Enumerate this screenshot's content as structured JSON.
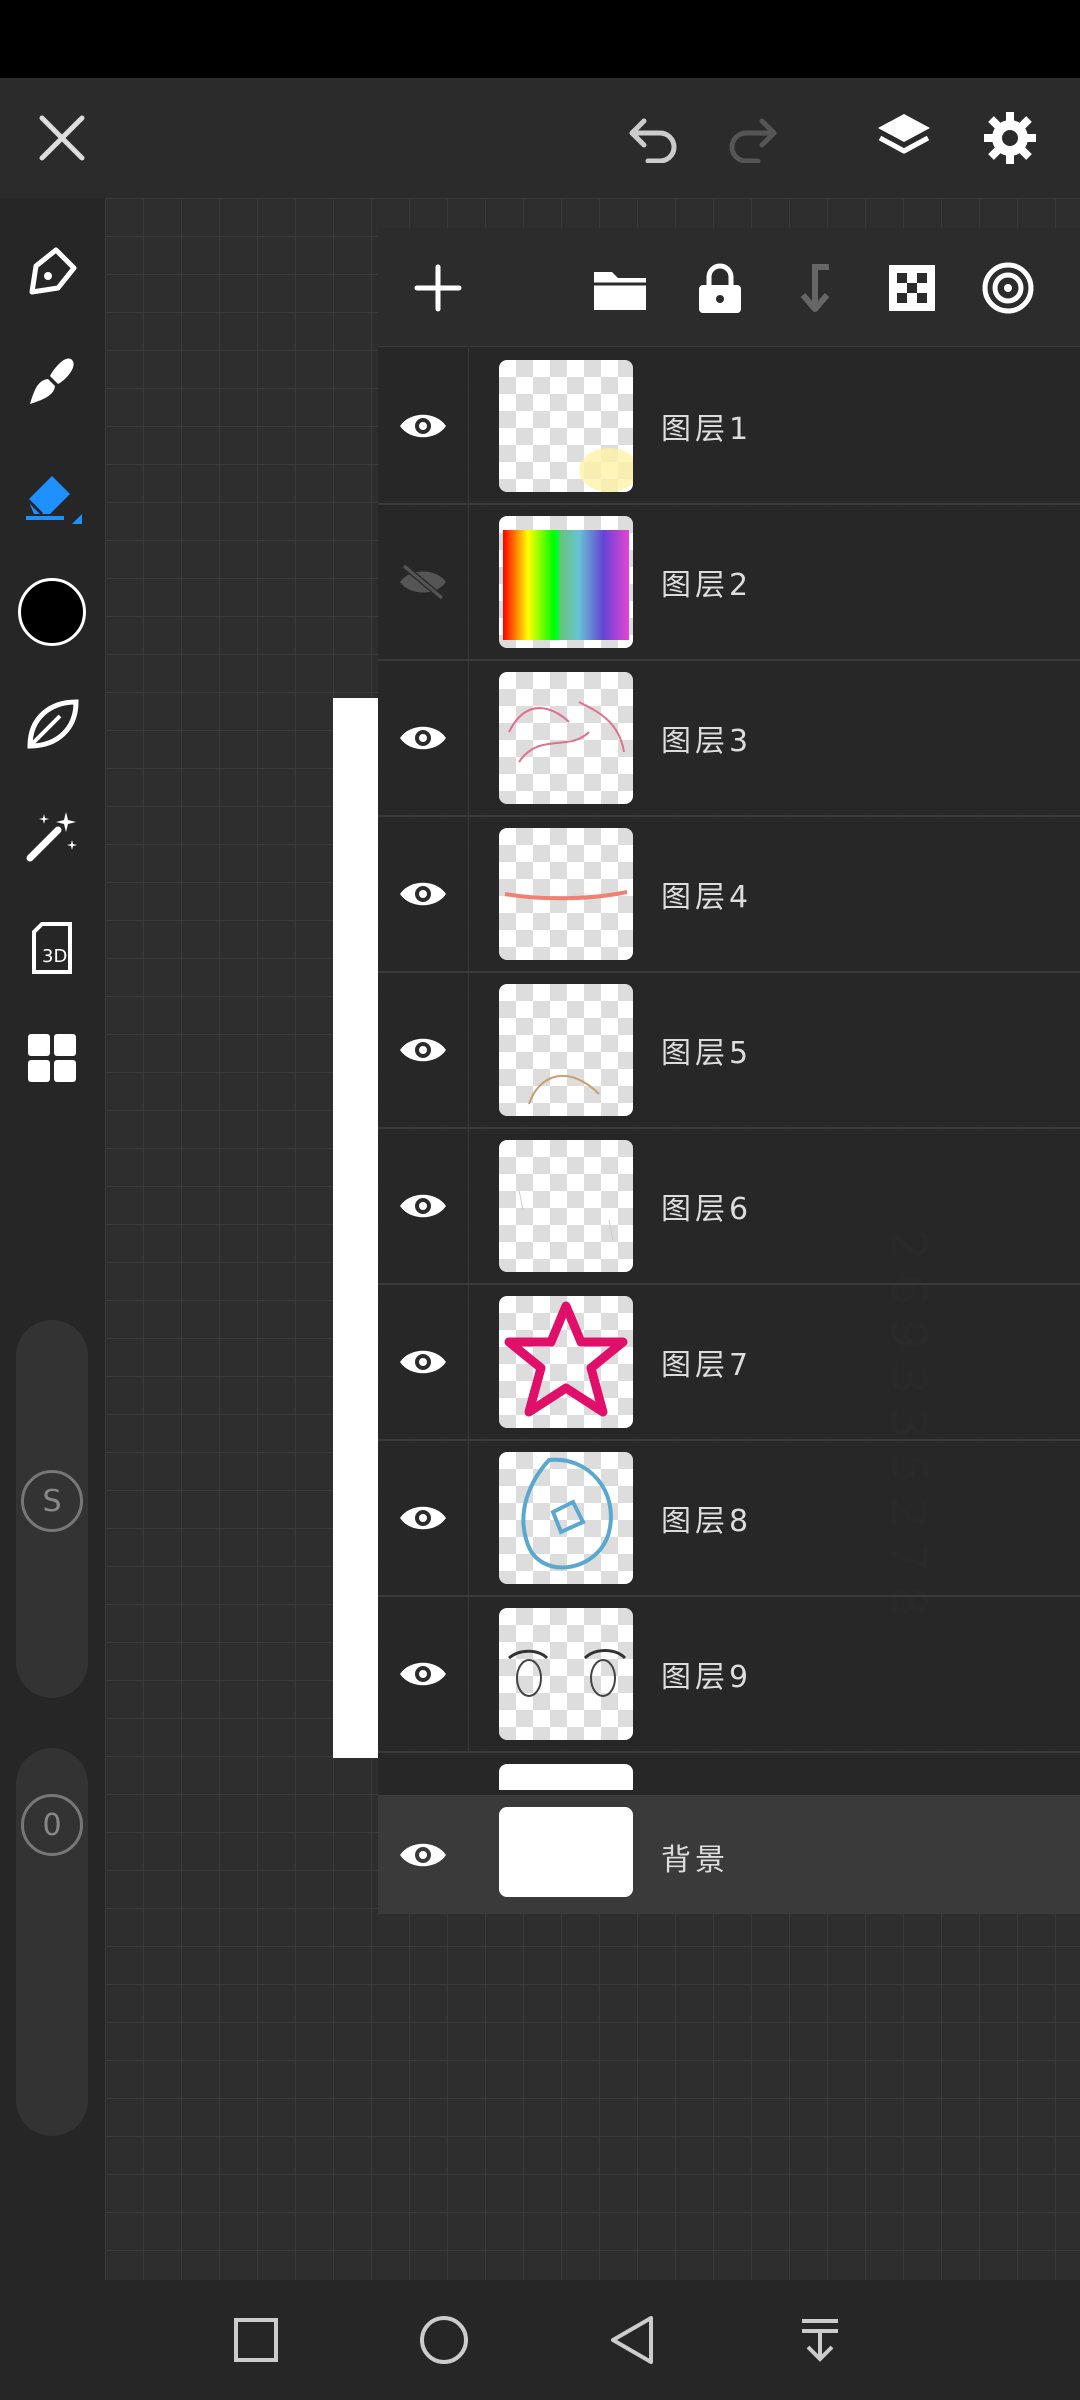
{
  "layers": [
    {
      "name": "图层1",
      "visible": true
    },
    {
      "name": "图层2",
      "visible": false
    },
    {
      "name": "图层3",
      "visible": true
    },
    {
      "name": "图层4",
      "visible": true
    },
    {
      "name": "图层5",
      "visible": true
    },
    {
      "name": "图层6",
      "visible": true
    },
    {
      "name": "图层7",
      "visible": true
    },
    {
      "name": "图层8",
      "visible": true
    },
    {
      "name": "图层9",
      "visible": true
    }
  ],
  "background_layer": {
    "name": "背景",
    "visible": true
  },
  "left_toolbar": {
    "selected_tool": "eraser",
    "smudge_label": "S",
    "opacity_label": "0",
    "color_hex": "#000000"
  },
  "canvas": {
    "faint_digits": "269335278"
  },
  "colors": {
    "accent": "#1e90ff",
    "panel_bg": "#2c2c2c"
  }
}
